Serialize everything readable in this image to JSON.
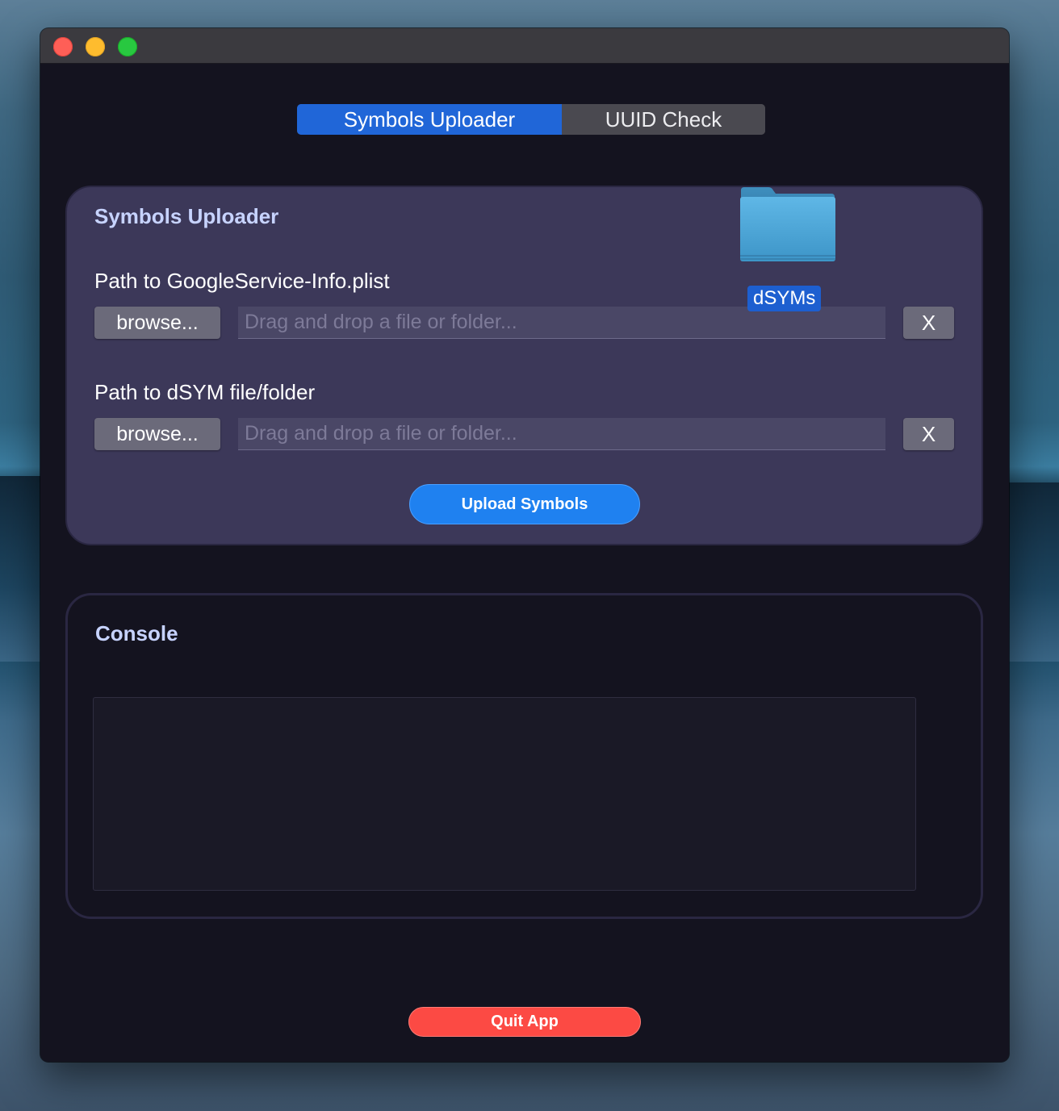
{
  "window": {
    "title": ""
  },
  "tabs": [
    {
      "label": "Symbols Uploader",
      "active": true
    },
    {
      "label": "UUID Check",
      "active": false
    }
  ],
  "uploader": {
    "title": "Symbols Uploader",
    "plist": {
      "label": "Path to GoogleService-Info.plist",
      "browse_label": "browse...",
      "placeholder": "Drag and drop a file or folder...",
      "value": "",
      "clear_label": "X"
    },
    "dsym": {
      "label": "Path to dSYM file/folder",
      "browse_label": "browse...",
      "placeholder": "Drag and drop a file or folder...",
      "value": "",
      "clear_label": "X"
    },
    "upload_label": "Upload Symbols"
  },
  "drag_item": {
    "label": "dSYMs",
    "icon": "folder-icon"
  },
  "console": {
    "title": "Console",
    "output": ""
  },
  "quit_label": "Quit App",
  "colors": {
    "accent": "#2066d8",
    "upload_button": "#1f81f0",
    "quit_button": "#fc4a44",
    "panel": "#3c3859",
    "window_bg": "#14131f"
  }
}
